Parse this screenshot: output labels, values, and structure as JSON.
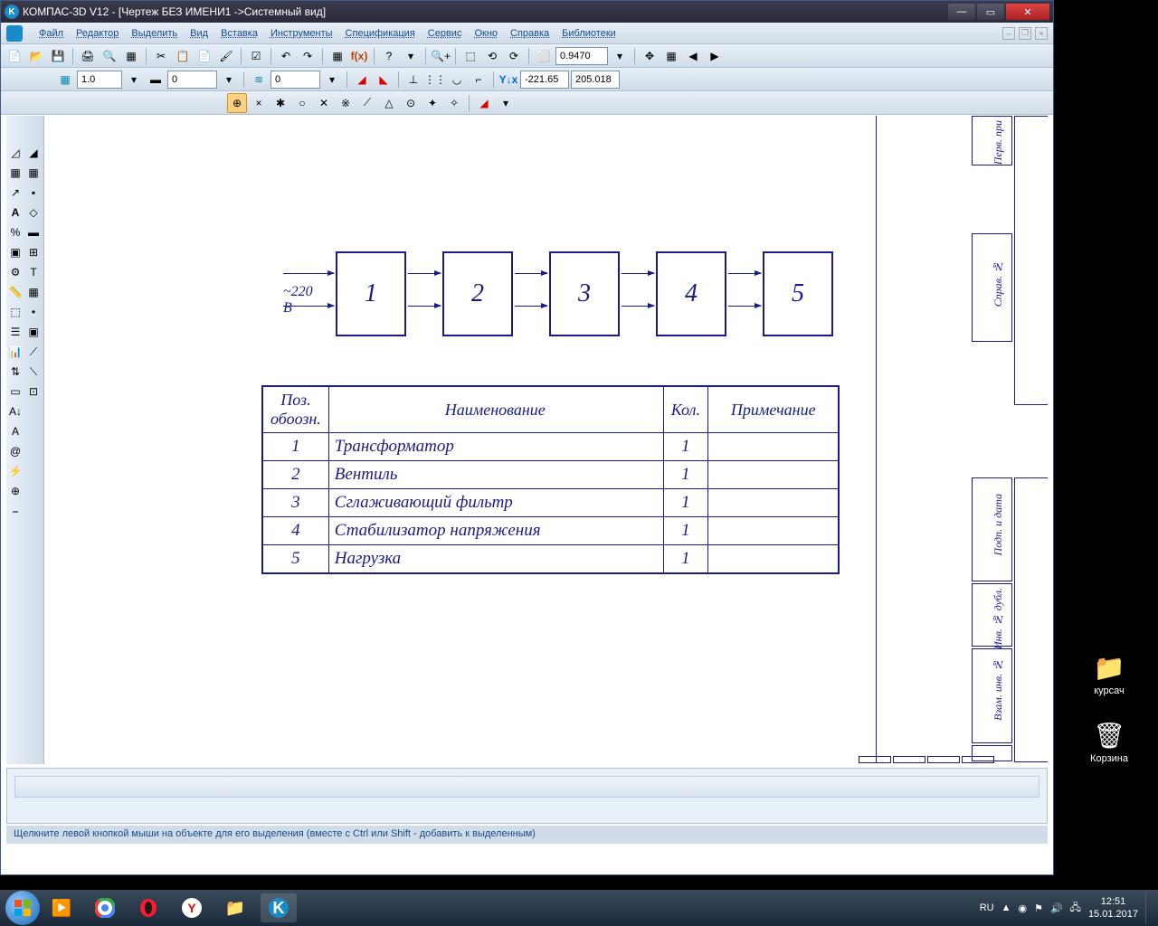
{
  "titlebar": {
    "app": "КОМПАС-3D V12",
    "doc": "[Чертеж БЕЗ ИМЕНИ1 ->Системный вид]"
  },
  "menu": [
    "Файл",
    "Редактор",
    "Выделить",
    "Вид",
    "Вставка",
    "Инструменты",
    "Спецификация",
    "Сервис",
    "Окно",
    "Справка",
    "Библиотеки"
  ],
  "toolbar1": {
    "zoom": "0.9470"
  },
  "toolbar2": {
    "scale": "1.0",
    "layer": "0",
    "style": "0",
    "coordX": "-221.65",
    "coordY": "205.018"
  },
  "diagram": {
    "voltage": "~220 В",
    "boxes": [
      "1",
      "2",
      "3",
      "4",
      "5"
    ]
  },
  "table": {
    "headers": {
      "pos": "Поз. обоозн.",
      "name": "Наименование",
      "qty": "Кол.",
      "note": "Примечание"
    },
    "rows": [
      {
        "pos": "1",
        "name": "Трансформатор",
        "qty": "1",
        "note": ""
      },
      {
        "pos": "2",
        "name": "Вентиль",
        "qty": "1",
        "note": ""
      },
      {
        "pos": "3",
        "name": "Сглаживающий фильтр",
        "qty": "1",
        "note": ""
      },
      {
        "pos": "4",
        "name": "Стабилизатор напряжения",
        "qty": "1",
        "note": ""
      },
      {
        "pos": "5",
        "name": "Нагрузка",
        "qty": "1",
        "note": ""
      }
    ]
  },
  "frame_labels": {
    "perv": "Перв. при",
    "sprav": "Справ. №",
    "podp": "Подп. и дата",
    "inv": "Инв. № дубл.",
    "vzam": "Взам. инв. №"
  },
  "statusbar": "Щелкните левой кнопкой мыши на объекте для его выделения (вместе с Ctrl или Shift - добавить к выделенным)",
  "desktop": {
    "kursach": "курсач",
    "trash": "Корзина"
  },
  "tray": {
    "lang": "RU",
    "time": "12:51",
    "date": "15.01.2017"
  }
}
